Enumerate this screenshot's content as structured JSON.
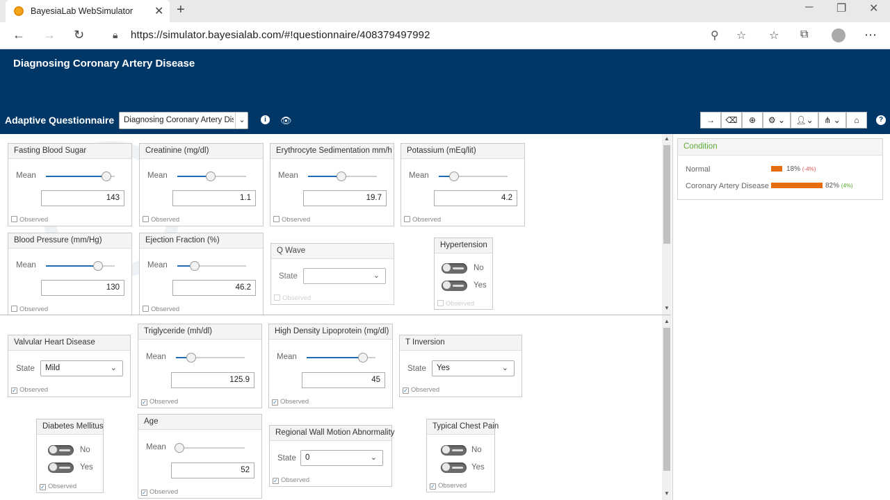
{
  "browser": {
    "tab_title": "BayesiaLab WebSimulator",
    "tab_close": "✕",
    "new_tab": "+",
    "url": "https://simulator.bayesialab.com/#!questionnaire/408379497992",
    "icons": [
      "back-icon",
      "forward-icon",
      "reload-icon",
      "lock-icon",
      "zoom-icon",
      "star-icon",
      "favorites-icon",
      "collections-icon",
      "profile-icon",
      "more-icon"
    ]
  },
  "app": {
    "title": "Diagnosing Coronary Artery Disease",
    "questionnaire_label": "Adaptive Questionnaire",
    "questionnaire_select": "Diagnosing Coronary Artery Disease"
  },
  "observed_label": "Observed",
  "mean_label": "Mean",
  "state_label": "State",
  "top_cards": {
    "fasting_blood_sugar": {
      "title": "Fasting Blood Sugar",
      "value": "143",
      "slider": 0.88
    },
    "creatinine": {
      "title": "Creatinine (mg/dl)",
      "value": "1.1",
      "slider": 0.48
    },
    "esr": {
      "title": "Erythrocyte Sedimentation mm/h",
      "value": "19.7",
      "slider": 0.48
    },
    "potassium": {
      "title": "Potassium (mEq/lit)",
      "value": "4.2",
      "slider": 0.22
    },
    "blood_pressure": {
      "title": "Blood Pressure (mm/Hg)",
      "value": "130",
      "slider": 0.76
    },
    "ejection_fraction": {
      "title": "Ejection Fraction (%)",
      "value": "46.2",
      "slider": 0.25
    },
    "q_wave": {
      "title": "Q Wave",
      "value": ""
    },
    "hypertension": {
      "title": "Hypertension",
      "no": "No",
      "yes": "Yes"
    }
  },
  "bottom_cards": {
    "valvular": {
      "title": "Valvular Heart Disease",
      "value": "Mild"
    },
    "triglyceride": {
      "title": "Triglyceride (mh/dl)",
      "value": "125.9",
      "slider": 0.22
    },
    "hdl": {
      "title": "High Density Lipoprotein (mg/dl)",
      "value": "45",
      "slider": 0.82
    },
    "t_inversion": {
      "title": "T Inversion",
      "value": "Yes"
    },
    "diabetes": {
      "title": "Diabetes Mellitus",
      "no": "No",
      "yes": "Yes"
    },
    "age": {
      "title": "Age",
      "value": "52",
      "slider": 0.05
    },
    "rwma": {
      "title": "Regional Wall Motion Abnormality",
      "value": "0"
    },
    "chest_pain": {
      "title": "Typical Chest Pain",
      "no": "No",
      "yes": "Yes"
    }
  },
  "condition": {
    "title": "Condition",
    "rows": [
      {
        "label": "Normal",
        "pct": "18%",
        "delta": "(-4%)",
        "frac": 0.18
      },
      {
        "label": "Coronary Artery Disease",
        "pct": "82%",
        "delta": "(4%)",
        "frac": 0.82
      }
    ]
  },
  "colors": {
    "header": "#003767",
    "slider": "#1f6cb5",
    "bar": "#e46c0a",
    "condition_title": "#5aa832"
  }
}
